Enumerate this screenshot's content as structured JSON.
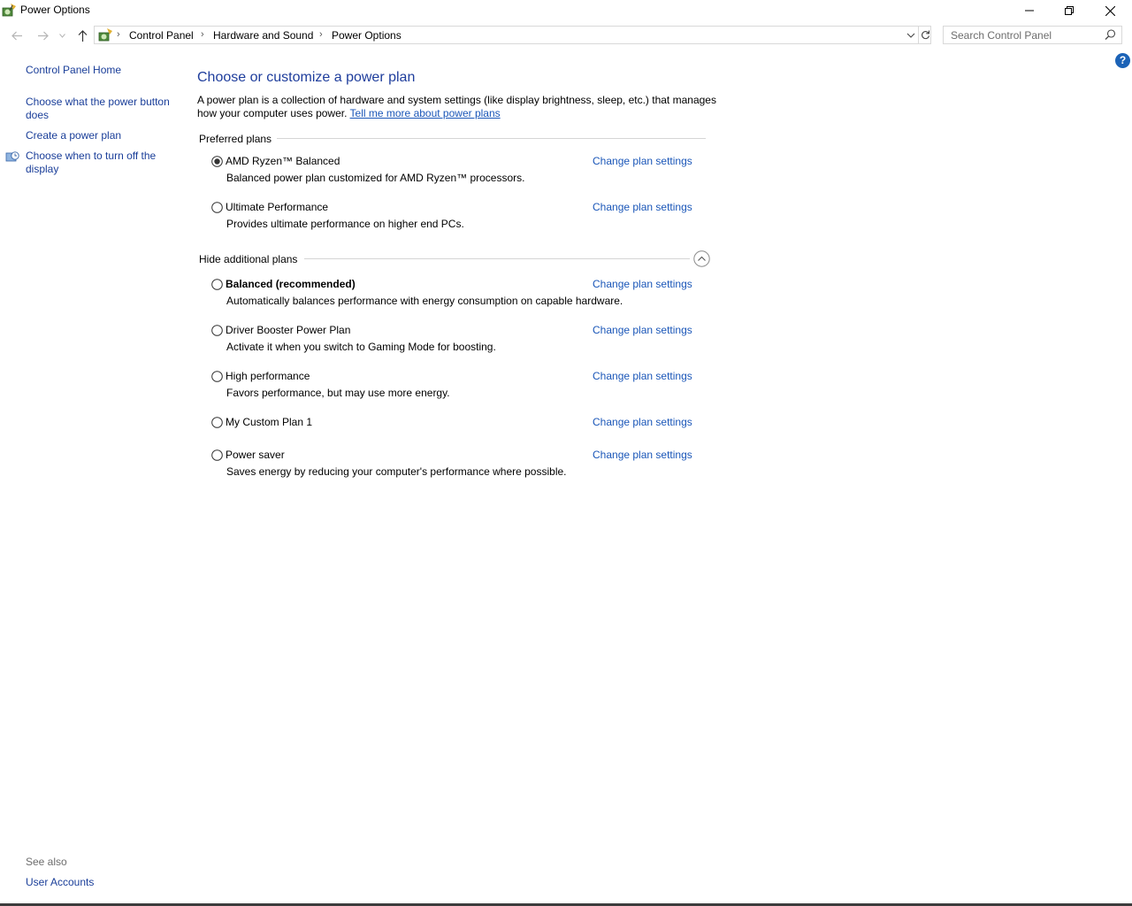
{
  "window": {
    "title": "Power Options",
    "icon": "power-options-icon"
  },
  "address_bar": {
    "breadcrumbs": [
      "Control Panel",
      "Hardware and Sound",
      "Power Options"
    ],
    "search_placeholder": "Search Control Panel"
  },
  "help": {
    "label": "?"
  },
  "left_pane": {
    "links": [
      "Control Panel Home",
      "Choose what the power button does",
      "Create a power plan",
      "Choose when to turn off the display"
    ],
    "see_also_label": "See also",
    "see_also_links": [
      "User Accounts"
    ]
  },
  "main": {
    "heading": "Choose or customize a power plan",
    "intro_text": "A power plan is a collection of hardware and system settings (like display brightness, sleep, etc.) that manages how your computer uses power. ",
    "intro_link": "Tell me more about power plans",
    "preferred_label": "Preferred plans",
    "additional_label": "Hide additional plans",
    "change_label": "Change plan settings",
    "plans": [
      {
        "name": "AMD Ryzen™ Balanced",
        "description": "Balanced power plan customized for AMD Ryzen™ processors.",
        "selected": true
      },
      {
        "name": "Ultimate Performance",
        "description": "Provides ultimate performance on higher end PCs.",
        "selected": false
      },
      {
        "name": "Balanced (recommended)",
        "description": "Automatically balances performance with energy consumption on capable hardware.",
        "selected": false
      },
      {
        "name": "Driver Booster Power Plan",
        "description": "Activate it when you switch to Gaming Mode for boosting.",
        "selected": false
      },
      {
        "name": "High performance",
        "description": "Favors performance, but may use more energy.",
        "selected": false
      },
      {
        "name": "My Custom Plan 1",
        "description": "",
        "selected": false
      },
      {
        "name": "Power saver",
        "description": "Saves energy by reducing your computer's performance where possible.",
        "selected": false
      }
    ]
  }
}
